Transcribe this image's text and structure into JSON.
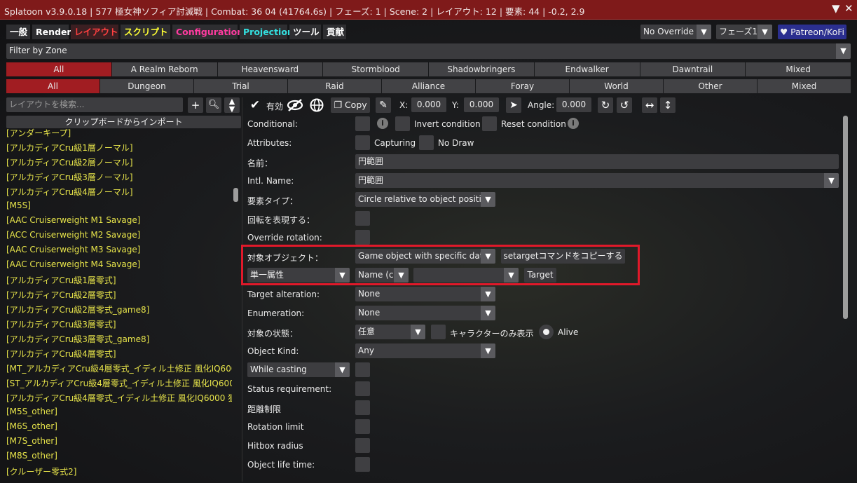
{
  "titlebar": {
    "title": "Splatoon v3.9.0.18 | 577 極女神ソフィア討滅戦 | Combat: 36 04 (41764.6s) | フェーズ: 1 | Scene: 2 | レイアウト: 12 | 要素: 44 | -0.2, 2.9",
    "collapse_icon": "▼",
    "close_icon": "✕"
  },
  "tabs": [
    {
      "label": "一般",
      "color": "#ffffff"
    },
    {
      "label": "Render",
      "color": "#ffffff"
    },
    {
      "label": "レイアウト",
      "color": "#ff4040"
    },
    {
      "label": "スクリプト",
      "color": "#ffff33"
    },
    {
      "label": "Configurations",
      "color": "#ff3ba0"
    },
    {
      "label": "Projection",
      "color": "#33e0e0"
    },
    {
      "label": "ツール",
      "color": "#ffffff"
    },
    {
      "label": "貢献",
      "color": "#ffffff"
    }
  ],
  "header_right": {
    "override": "No Override",
    "phase": "フェーズ1",
    "patreon": "♥ Patreon/KoFi"
  },
  "filter": {
    "label": "Filter by Zone"
  },
  "expansions": [
    "All",
    "A Realm Reborn",
    "Heavensward",
    "Stormblood",
    "Shadowbringers",
    "Endwalker",
    "Dawntrail",
    "Mixed"
  ],
  "content_types": [
    "All",
    "Dungeon",
    "Trial",
    "Raid",
    "Alliance",
    "Foray",
    "World",
    "Other",
    "Mixed"
  ],
  "left": {
    "search_placeholder": "レイアウトを検索...",
    "import_button": "クリップボードからインポート",
    "items": [
      "[アンダーキープ]",
      "[アルカディアCru級1層ノーマル]",
      "[アルカディアCru級2層ノーマル]",
      "[アルカディアCru級3層ノーマル]",
      "[アルカディアCru級4層ノーマル]",
      "[M5S]",
      "[AAC Cruiserweight M1 Savage]",
      "[ACC Cruiserweight M2 Savage]",
      "[AAC Cruiserweight M3 Savage]",
      "[AAC Cruiserweight M4 Savage]",
      "[アルカディアCru級1層零式]",
      "[アルカディアCru級2層零式]",
      "[アルカディアCru級2層零式_game8]",
      "[アルカディアCru級3層零式]",
      "[アルカディアCru級3層零式_game8]",
      "[アルカディアCru級4層零式]",
      "[MT_アルカディアCru級4層零式_イディル土修正 風化IQ600",
      "[ST_アルカディアCru級4層零式_イディル土修正 風化IQ600",
      "[アルカディアCru級4層零式_イディル土修正 風化IQ6000 狙",
      "[M5S_other]",
      "[M6S_other]",
      "[M7S_other]",
      "[M8S_other]",
      "[クルーザー零式2]"
    ]
  },
  "toolbar": {
    "enabled": "有効",
    "copy": "Copy",
    "x_label": "X:",
    "x_value": "0.000",
    "y_label": "Y:",
    "y_value": "0.000",
    "angle_label": "Angle:",
    "angle_value": "0.000"
  },
  "form": {
    "conditional": "Conditional:",
    "invert_condition": "Invert condition",
    "reset_condition": "Reset condition",
    "attributes": "Attributes:",
    "capturing": "Capturing",
    "no_draw": "No Draw",
    "name_label": "名前：",
    "name_value": "円範囲",
    "intl_name_label": "Intl. Name:",
    "intl_name_value": "円範囲",
    "element_type_label": "要素タイプ：",
    "element_type_value": "Circle relative to object positio",
    "rotation_label": "回転を表現する：",
    "override_rotation": "Override rotation:",
    "target_object_label": "対象オブジェクト：",
    "target_object_value": "Game object with specific data",
    "copy_settarget": "setargetコマンドをコピーする",
    "single_attribute": "単一属性",
    "name_c": "Name (c",
    "target_button": "Target",
    "target_alteration_label": "Target alteration:",
    "target_alteration_value": "None",
    "enumeration_label": "Enumeration:",
    "enumeration_value": "None",
    "object_state_label": "対象の状態：",
    "object_state_value": "任意",
    "characters_only": "キャラクターのみ表示",
    "alive": "Alive",
    "object_kind_label": "Object Kind:",
    "object_kind_value": "Any",
    "while_casting": "While casting",
    "status_requirement": "Status requirement:",
    "distance_limit": "距離制限",
    "rotation_limit": "Rotation limit",
    "hitbox_radius": "Hitbox radius",
    "object_life_time": "Object life time:"
  },
  "colors": {
    "accent_red": "#a11d22",
    "highlight_box": "#e0192a",
    "list_yellow": "#e6e34a",
    "patreon_blue": "#2b2f8f"
  }
}
